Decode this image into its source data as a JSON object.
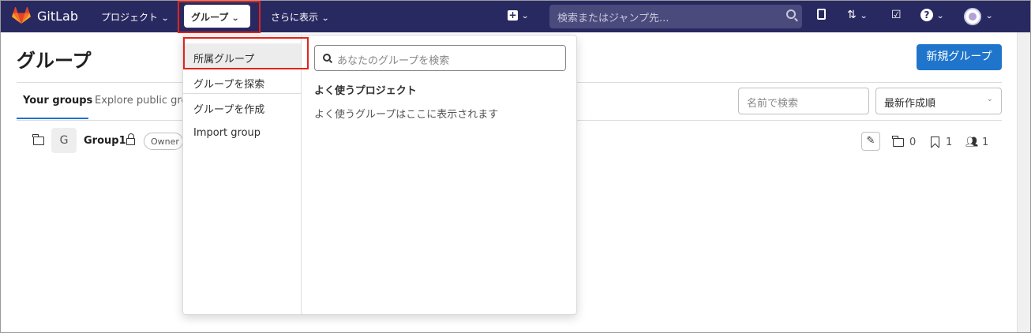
{
  "navbar": {
    "brand": "GitLab",
    "projects_label": "プロジェクト",
    "groups_label": "グループ",
    "more_label": "さらに表示",
    "search_placeholder": "検索またはジャンプ先...",
    "icons": [
      "plus-square-icon",
      "issues-icon",
      "merge-request-icon",
      "todo-icon",
      "help-icon"
    ],
    "colors": {
      "bg": "#292961",
      "accent": "#1f75cb",
      "highlight": "#e2231a"
    }
  },
  "page": {
    "title": "グループ",
    "new_group_button": "新規グループ",
    "tabs": [
      {
        "label": "Your groups",
        "active": true
      },
      {
        "label": "Explore public grou",
        "active": false
      }
    ],
    "filter_placeholder": "名前で検索",
    "sort_selected": "最新作成順"
  },
  "groups": [
    {
      "avatar_letter": "G",
      "name": "Group1",
      "role": "Owner",
      "subgroups": "0",
      "projects": "1",
      "members": "1"
    }
  ],
  "dropdown": {
    "items": [
      "所属グループ",
      "グループを探索",
      "グループを作成",
      "Import group"
    ],
    "search_placeholder": "あなたのグループを検索",
    "frequent_heading": "よく使うプロジェクト",
    "empty_text": "よく使うグループはここに表示されます"
  }
}
